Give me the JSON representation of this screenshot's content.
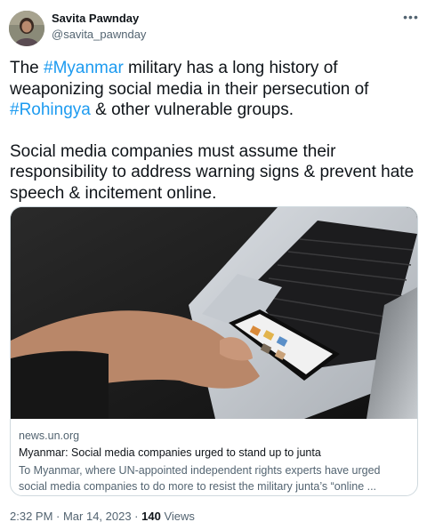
{
  "author": {
    "name": "Savita Pawnday",
    "handle": "@savita_pawnday",
    "avatar_icon": "profile-photo-icon"
  },
  "more_icon": "more-horizontal-icon",
  "tweet": {
    "line1_prefix": "The ",
    "hashtag1": "#Myanmar",
    "line1_suffix": " military has a long history of weaponizing social media in their persecution of ",
    "hashtag2": "#Rohingya",
    "line1_end": " & other vulnerable groups.",
    "paragraph2": "Social media companies must assume their responsibility to address warning signs & prevent hate speech & incitement online."
  },
  "card": {
    "image_icon": "hand-holding-phone-over-laptop-image",
    "domain": "news.un.org",
    "title": "Myanmar: Social media companies urged to stand up to junta",
    "description": "To Myanmar, where UN-appointed independent rights experts have urged social media companies to do more to resist the military junta’s “online ..."
  },
  "meta": {
    "timestamp": "2:32 PM · Mar 14, 2023 · ",
    "views_count": "140",
    "views_label": " Views"
  },
  "colors": {
    "accent": "#1d9bf0",
    "text": "#0f1419",
    "secondary": "#536471",
    "border": "#cfd9de"
  }
}
